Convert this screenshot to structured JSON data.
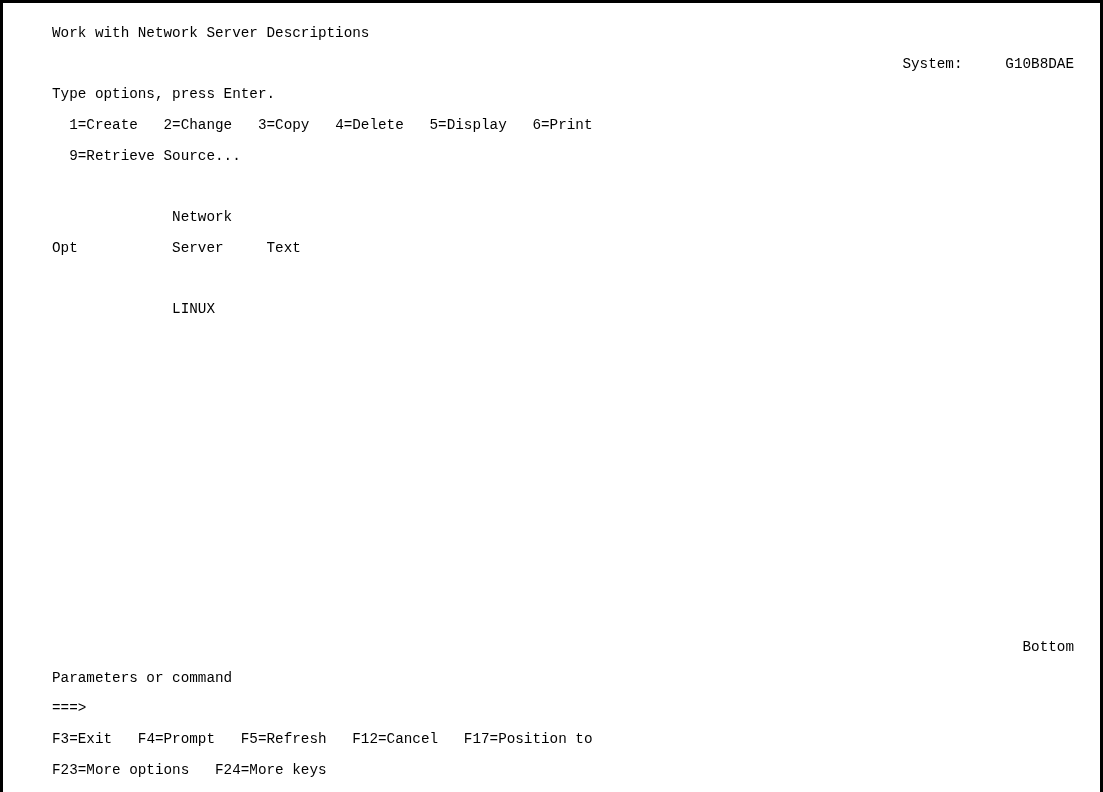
{
  "title": "Work with Network Server Descriptions",
  "system": {
    "label": "System:",
    "value": "G10B8DAE"
  },
  "instruction": "Type options, press Enter.",
  "options": [
    [
      "1=Create",
      "2=Change",
      "3=Copy",
      "4=Delete",
      "5=Display",
      "6=Print"
    ],
    [
      "9=Retrieve Source..."
    ]
  ],
  "columns": [
    "Opt",
    "Network Server",
    "Text"
  ],
  "rows": [
    {
      "network_server": "LINUX"
    }
  ],
  "position": "Bottom",
  "command": {
    "label": "Parameters or command",
    "prompt": "===>"
  },
  "function_keys": [
    [
      "F3=Exit",
      "F4=Prompt",
      "F5=Refresh",
      "F12=Cancel",
      "F17=Position to"
    ],
    [
      "F23=More options",
      "F24=More keys"
    ]
  ]
}
